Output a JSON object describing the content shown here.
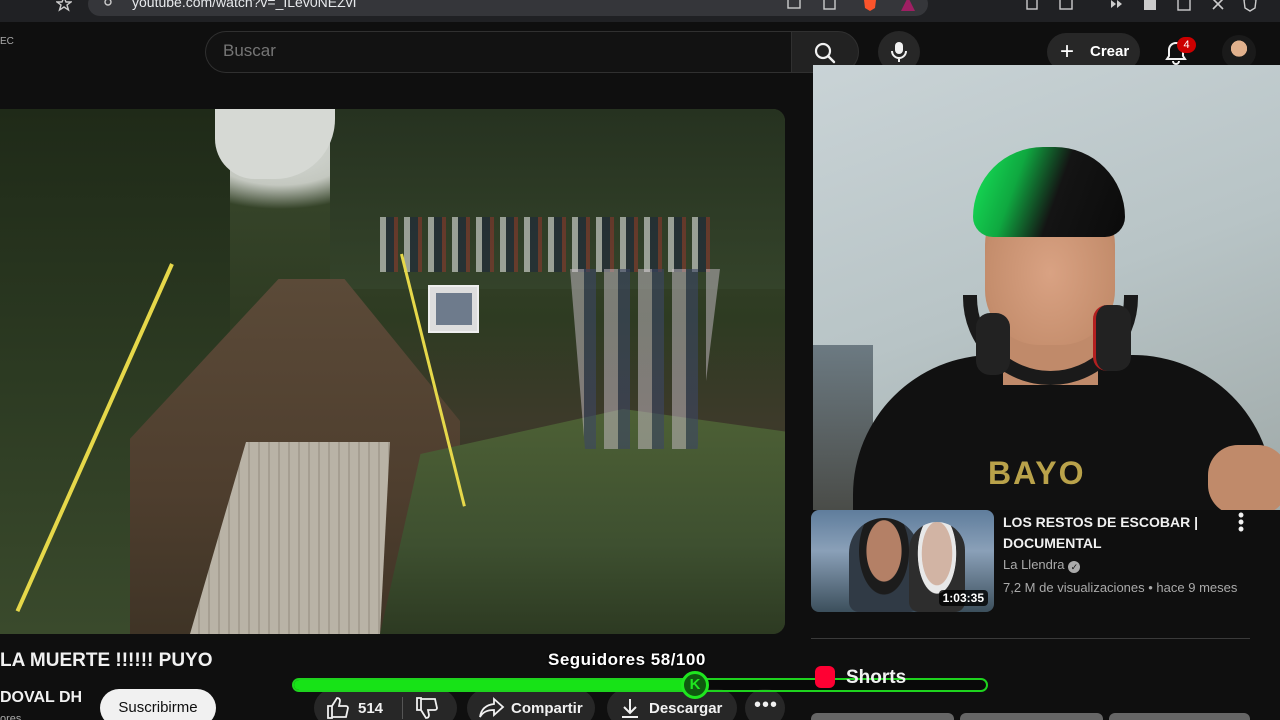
{
  "browser": {
    "url": "youtube.com/watch?v=_ILev0NEZvI"
  },
  "masthead": {
    "country_code": "EC",
    "search_placeholder": "Buscar",
    "create_label": "Crear",
    "notification_count": "4"
  },
  "video": {
    "title": "LA MUERTE !!!!!! PUYO",
    "channel_name": "DOVAL DH",
    "channel_sub": "ores",
    "subscribe_label": "Suscribirme",
    "like_count": "514",
    "share_label": "Compartir",
    "download_label": "Descargar"
  },
  "overlay": {
    "followers_text": "Seguidores 58/100",
    "followers_current": 58,
    "followers_goal": 100,
    "knob_letter": "K",
    "shirt_text": "BAYO",
    "accent_color": "#17e317"
  },
  "recommended": {
    "title": "LOS RESTOS DE ESCOBAR | DOCUMENTAL",
    "channel": "La Llendra",
    "views": "7,2 M de visualizaciones",
    "age": "hace 9 meses",
    "duration": "1:03:35"
  },
  "shorts": {
    "label": "Shorts"
  }
}
